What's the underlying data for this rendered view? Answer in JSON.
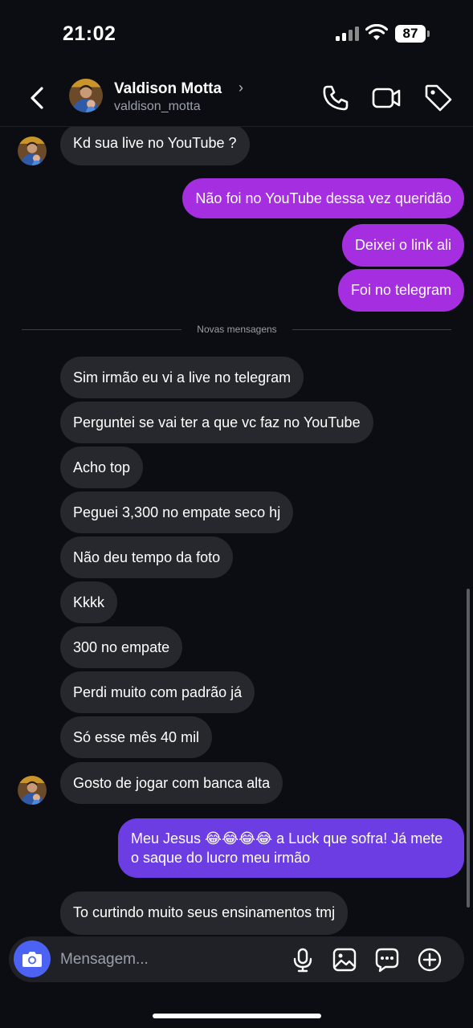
{
  "status_bar": {
    "time": "21:02",
    "battery": "87"
  },
  "header": {
    "name": "Valdison Motta",
    "chevron": "›",
    "username": "valdison_motta",
    "icons": [
      "back-icon",
      "phone-icon",
      "video-icon",
      "tag-icon"
    ]
  },
  "divider": {
    "label": "Novas mensagens"
  },
  "messages": [
    {
      "text": "Kd sua live no YouTube ?",
      "sender": "them"
    },
    {
      "text": "Não foi no YouTube dessa vez queridão",
      "sender": "me"
    },
    {
      "text": "Deixei o link ali",
      "sender": "me"
    },
    {
      "text": "Foi no telegram",
      "sender": "me"
    },
    {
      "text": "Sim irmão eu vi a live no telegram",
      "sender": "them"
    },
    {
      "text": "Perguntei se vai ter a que vc faz no YouTube",
      "sender": "them"
    },
    {
      "text": "Acho top",
      "sender": "them"
    },
    {
      "text": "Peguei 3,300 no empate seco hj",
      "sender": "them"
    },
    {
      "text": "Não deu tempo da foto",
      "sender": "them"
    },
    {
      "text": "Kkkk",
      "sender": "them"
    },
    {
      "text": "300 no empate",
      "sender": "them"
    },
    {
      "text": "Perdi muito com padrão já",
      "sender": "them"
    },
    {
      "text": "Só esse mês 40 mil",
      "sender": "them"
    },
    {
      "text": "Gosto de jogar com banca alta",
      "sender": "them"
    },
    {
      "text": "Meu Jesus 😂😂😂😂 a Luck que sofra! Já mete o saque do lucro meu irmão",
      "sender": "me"
    },
    {
      "text": "To curtindo muito seus ensinamentos tmj",
      "sender": "them"
    }
  ],
  "composer": {
    "placeholder": "Mensagem...",
    "icons": [
      "camera-icon",
      "microphone-icon",
      "gallery-icon",
      "sticker-icon",
      "plus-icon"
    ]
  },
  "colors": {
    "background": "#0b0d12",
    "incoming_bubble": "#26282e",
    "outgoing_purple": "#a42ee0",
    "outgoing_violet": "#6c3de3",
    "camera_button": "#4b62f3"
  }
}
